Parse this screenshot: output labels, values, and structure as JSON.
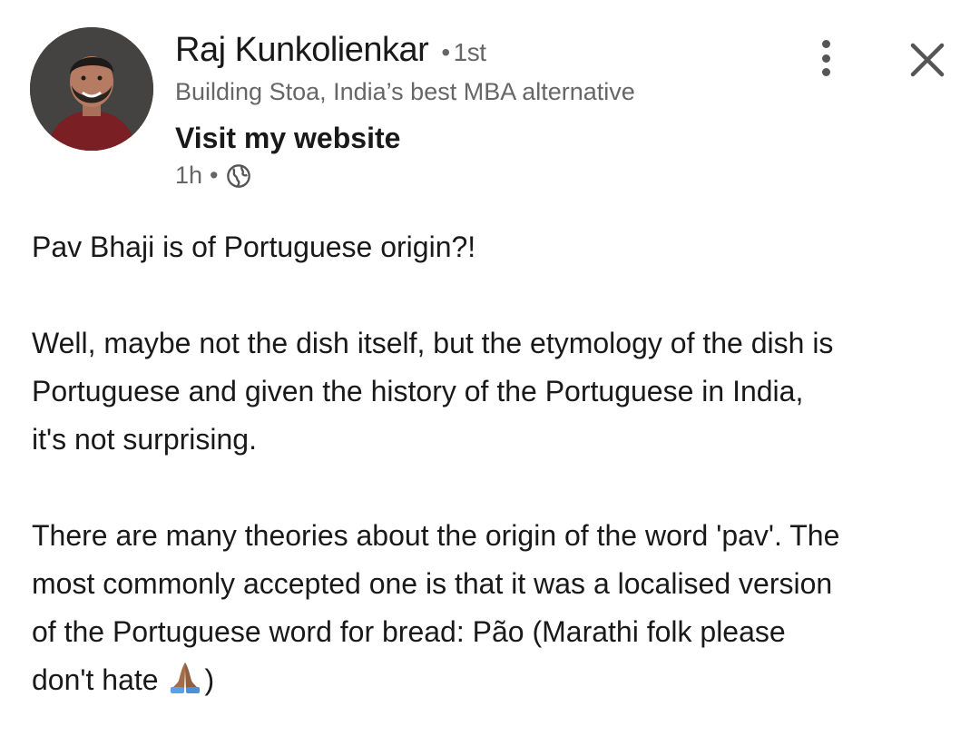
{
  "post": {
    "author": {
      "name": "Raj Kunkolienkar",
      "degree_separator": "•",
      "degree": "1st",
      "headline": "Building Stoa, India’s best MBA alternative",
      "link_label": "Visit my website"
    },
    "meta": {
      "time": "1h",
      "separator": "•",
      "visibility_icon": "globe-icon"
    },
    "body": {
      "paragraph_1": "Pav Bhaji is of Portuguese origin?!",
      "paragraph_2": "Well, maybe not the dish itself, but the etymology of the dish is\nPortuguese and given the history of the Portuguese in India,\nit's not surprising.",
      "paragraph_3": "There are many theories about the origin of the word 'pav'. The\nmost commonly accepted one is that it was a localised version\nof the Portuguese word for bread: Pão (Marathi folk please\ndon't hate ",
      "paragraph_3_end": ")",
      "emoji": "folded-hands-emoji"
    }
  },
  "header_icons": {
    "more": "more-vertical-icon",
    "close": "close-icon"
  },
  "colors": {
    "text_primary": "#191919",
    "text_secondary": "#666666",
    "icon": "#555555",
    "background": "#ffffff"
  }
}
